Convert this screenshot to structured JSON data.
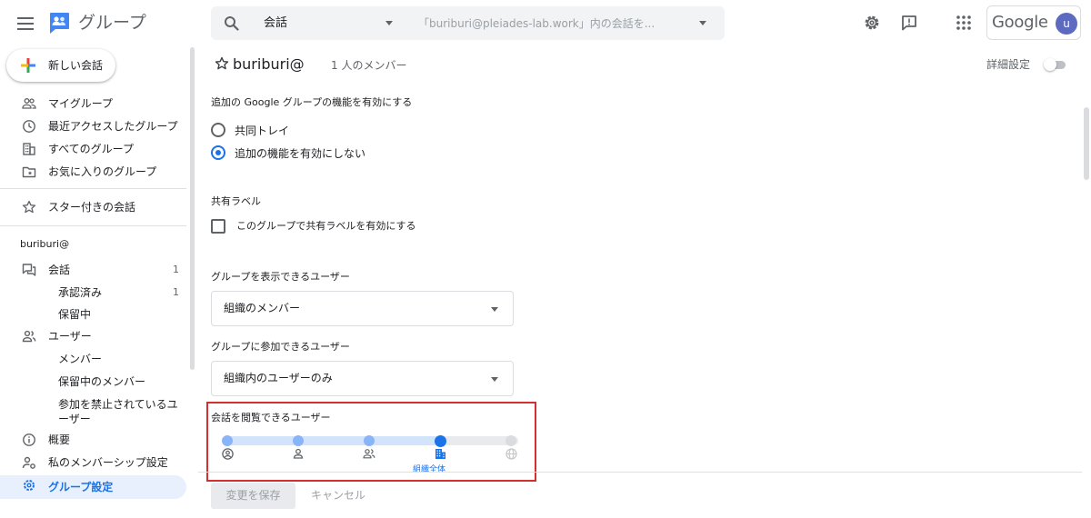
{
  "header": {
    "app_title": "グループ",
    "search_scope": "会話",
    "search_placeholder": "「buriburi@pleiades-lab.work」内の会話を...",
    "account_logo": "Google",
    "avatar_letter": "u",
    "icons": [
      "menu-icon",
      "groups-logo-icon",
      "search-icon",
      "settings-icon",
      "feedback-icon",
      "apps-icon"
    ]
  },
  "sidebar": {
    "new_conversation": "新しい会話",
    "items": [
      {
        "label": "マイグループ",
        "icon": "people-icon"
      },
      {
        "label": "最近アクセスしたグループ",
        "icon": "clock-icon"
      },
      {
        "label": "すべてのグループ",
        "icon": "building-icon"
      },
      {
        "label": "お気に入りのグループ",
        "icon": "folder-star-icon"
      }
    ],
    "starred": "スター付きの会話",
    "group_name": "buriburi@",
    "conversations": {
      "label": "会話",
      "count": "1"
    },
    "approved": {
      "label": "承認済み",
      "count": "1"
    },
    "pending": {
      "label": "保留中"
    },
    "users": {
      "label": "ユーザー"
    },
    "members": "メンバー",
    "pending_members": "保留中のメンバー",
    "banned_users": "参加を禁止されているユ",
    "banned_users_2": "ーザー",
    "overview": "概要",
    "membership_settings": "私のメンバーシップ設定",
    "group_settings": "グループ設定"
  },
  "main": {
    "group_name": "buriburi@",
    "member_count": "1 人のメンバー",
    "detail_settings": "詳細設定",
    "features_title": "追加の Google グループの機能を有効にする",
    "radio_collab": "共同トレイ",
    "radio_none": "追加の機能を有効にしない",
    "labels_title": "共有ラベル",
    "labels_checkbox": "このグループで共有ラベルを有効にする",
    "view_group_title": "グループを表示できるユーザー",
    "view_group_value": "組織のメンバー",
    "join_group_title": "グループに参加できるユーザー",
    "join_group_value": "組織内のユーザーのみ",
    "view_conv_title": "会話を閲覧できるユーザー",
    "view_conv_selected_label": "組織全体",
    "view_conv_level": "4 of 5",
    "save": "変更を保存",
    "cancel": "キャンセル"
  },
  "colors": {
    "accent": "#1a73e8",
    "highlight": "#d32f2f",
    "rail_fill": "#d2e3fc",
    "dot_light": "#8ab4f8",
    "dot_off": "#dadce0"
  }
}
